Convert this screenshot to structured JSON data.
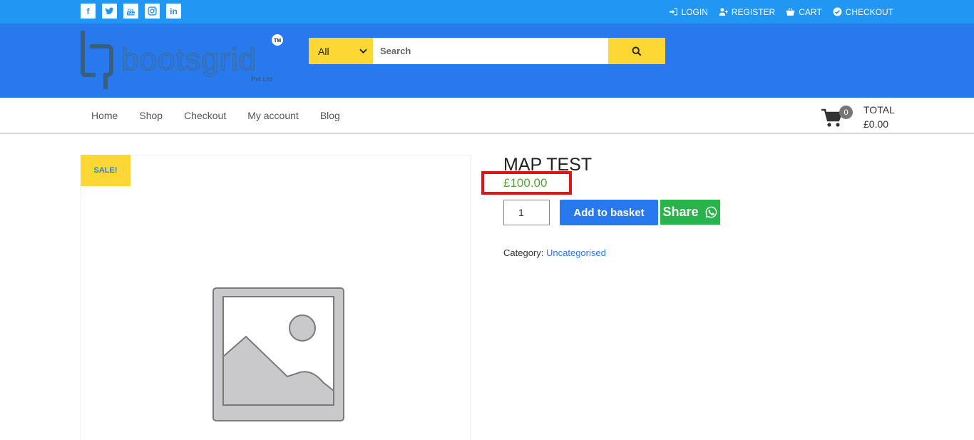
{
  "social": {
    "facebook": "f",
    "twitter": "twitter-icon",
    "youtube": "youtube-icon",
    "instagram": "instagram-icon",
    "linkedin": "in"
  },
  "toplinks": {
    "login": "LOGIN",
    "register": "REGISTER",
    "cart": "CART",
    "checkout": "CHECKOUT"
  },
  "logo": {
    "name": "bootsgrid",
    "sub": "Pvt Ltd",
    "tm": "TM"
  },
  "search": {
    "category": "All",
    "placeholder": "Search"
  },
  "nav": {
    "items": [
      {
        "label": "Home"
      },
      {
        "label": "Shop"
      },
      {
        "label": "Checkout"
      },
      {
        "label": "My account"
      },
      {
        "label": "Blog"
      }
    ]
  },
  "cart": {
    "count": "0",
    "total_label": "TOTAL",
    "total_value": "£0.00"
  },
  "product": {
    "sale_badge": "SALE!",
    "title": "MAP TEST",
    "price": "£100.00",
    "quantity": "1",
    "add_to_basket": "Add to basket",
    "share": "Share",
    "category_label": "Category:",
    "category_value": "Uncategorised"
  },
  "colors": {
    "topbar": "#2196f3",
    "header": "#2878ee",
    "accent_yellow": "#fdd835",
    "price_green": "#5ba13b",
    "share_green": "#28b34b",
    "highlight_red": "#e0141b"
  }
}
